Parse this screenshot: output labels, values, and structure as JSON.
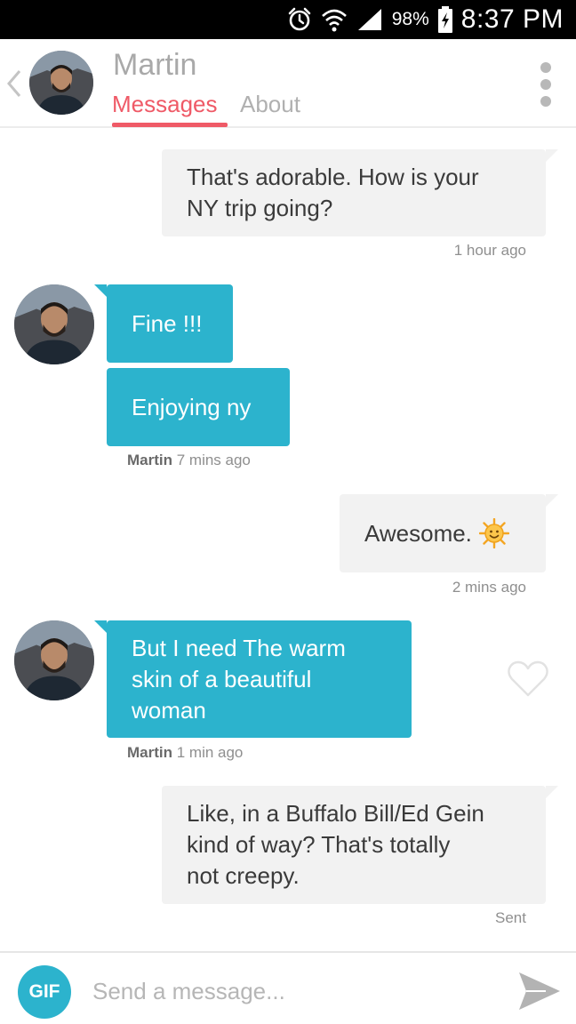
{
  "status_bar": {
    "battery": "98%",
    "time": "8:37 PM",
    "icons": [
      "alarm-icon",
      "wifi-icon",
      "signal-icon",
      "battery-charging-icon"
    ]
  },
  "header": {
    "name": "Martin",
    "tabs": [
      {
        "label": "Messages",
        "active": true
      },
      {
        "label": "About",
        "active": false
      }
    ],
    "icons": [
      "back-chevron-icon",
      "more-vertical-icon"
    ]
  },
  "messages": [
    {
      "direction": "outgoing",
      "lines": [
        "That's adorable. How is your",
        "NY trip going?"
      ],
      "meta": "1 hour ago"
    },
    {
      "direction": "incoming",
      "text": "Fine !!!"
    },
    {
      "direction": "incoming",
      "text": "Enjoying ny",
      "sender": "Martin",
      "meta": "7 mins ago"
    },
    {
      "direction": "outgoing",
      "text": "Awesome.",
      "emoji": "sun-smile-icon",
      "meta": "2 mins ago"
    },
    {
      "direction": "incoming",
      "lines": [
        "But I need The warm",
        "skin of a beautiful",
        "woman"
      ],
      "sender": "Martin",
      "meta": "1 min ago",
      "liked": false
    },
    {
      "direction": "outgoing",
      "lines": [
        "Like, in a Buffalo Bill/Ed Gein",
        "kind of way? That's totally",
        "not creepy."
      ],
      "meta": "Sent"
    }
  ],
  "composer": {
    "gif_label": "GIF",
    "placeholder": "Send a message..."
  },
  "colors": {
    "accent": "#ef5a67",
    "incoming_bubble": "#2cb3cd",
    "outgoing_bubble": "#f2f2f2"
  }
}
